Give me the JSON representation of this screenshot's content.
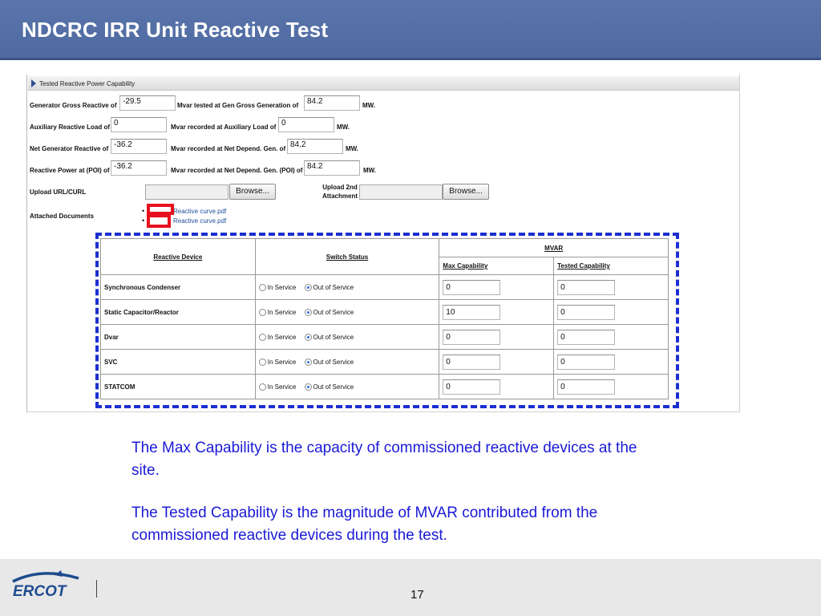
{
  "slide": {
    "title": "NDCRC IRR Unit Reactive Test",
    "page_number": "17"
  },
  "section": {
    "title": "Tested Reactive Power Capability"
  },
  "form": {
    "rows": [
      {
        "label": "Generator Gross Reactive of",
        "value": "-29.5",
        "label2": "Mvar tested at Gen Gross Generation of",
        "value2": "84.2",
        "unit": "MW."
      },
      {
        "label": "Auxiliary Reactive Load of",
        "value": "0",
        "label2": "Mvar recorded at Auxiliary Load of",
        "value2": "0",
        "unit": "MW."
      },
      {
        "label": "Net Generator Reactive of",
        "value": "-36.2",
        "label2": "Mvar recorded at Net Depend. Gen. of",
        "value2": "84.2",
        "unit": "MW."
      },
      {
        "label": "Reactive Power at (POI) of",
        "value": "-36.2",
        "label2": "Mvar recorded at Net Depend. Gen. (POI) of",
        "value2": "84.2",
        "unit": "MW."
      }
    ],
    "upload_label": "Upload URL/CURL",
    "upload2_label_line1": "Upload 2nd",
    "upload2_label_line2": "Attachment",
    "browse_label": "Browse...",
    "attached_label": "Attached Documents",
    "documents": [
      "Reactive curve.pdf",
      "Reactive curve.pdf"
    ]
  },
  "table": {
    "headers": {
      "device": "Reactive Device",
      "switch": "Switch Status",
      "mvar": "MVAR",
      "max": "Max Capability",
      "tested": "Tested Capability"
    },
    "status_options": {
      "in": "In Service",
      "out": "Out of Service"
    },
    "rows": [
      {
        "device": "Synchronous Condenser",
        "status": "out",
        "max": "0",
        "tested": "0"
      },
      {
        "device": "Static Capacitor/Reactor",
        "status": "out",
        "max": "10",
        "tested": "0"
      },
      {
        "device": "Dvar",
        "status": "out",
        "max": "0",
        "tested": "0"
      },
      {
        "device": "SVC",
        "status": "out",
        "max": "0",
        "tested": "0"
      },
      {
        "device": "STATCOM",
        "status": "out",
        "max": "0",
        "tested": "0"
      }
    ]
  },
  "explanation": {
    "para1": "The Max Capability is the capacity of commissioned reactive devices at the site.",
    "para2": "The Tested Capability is the magnitude of MVAR contributed from the commissioned reactive devices during the test."
  },
  "footer": {
    "logo_text": "ERCOT"
  },
  "colors": {
    "header_bg": "#5a75ab",
    "highlight_dash": "#1b2fd1",
    "highlight_red": "#e8101e",
    "explanation_text": "#1a1ad6",
    "logo_blue": "#1e4b8e"
  }
}
